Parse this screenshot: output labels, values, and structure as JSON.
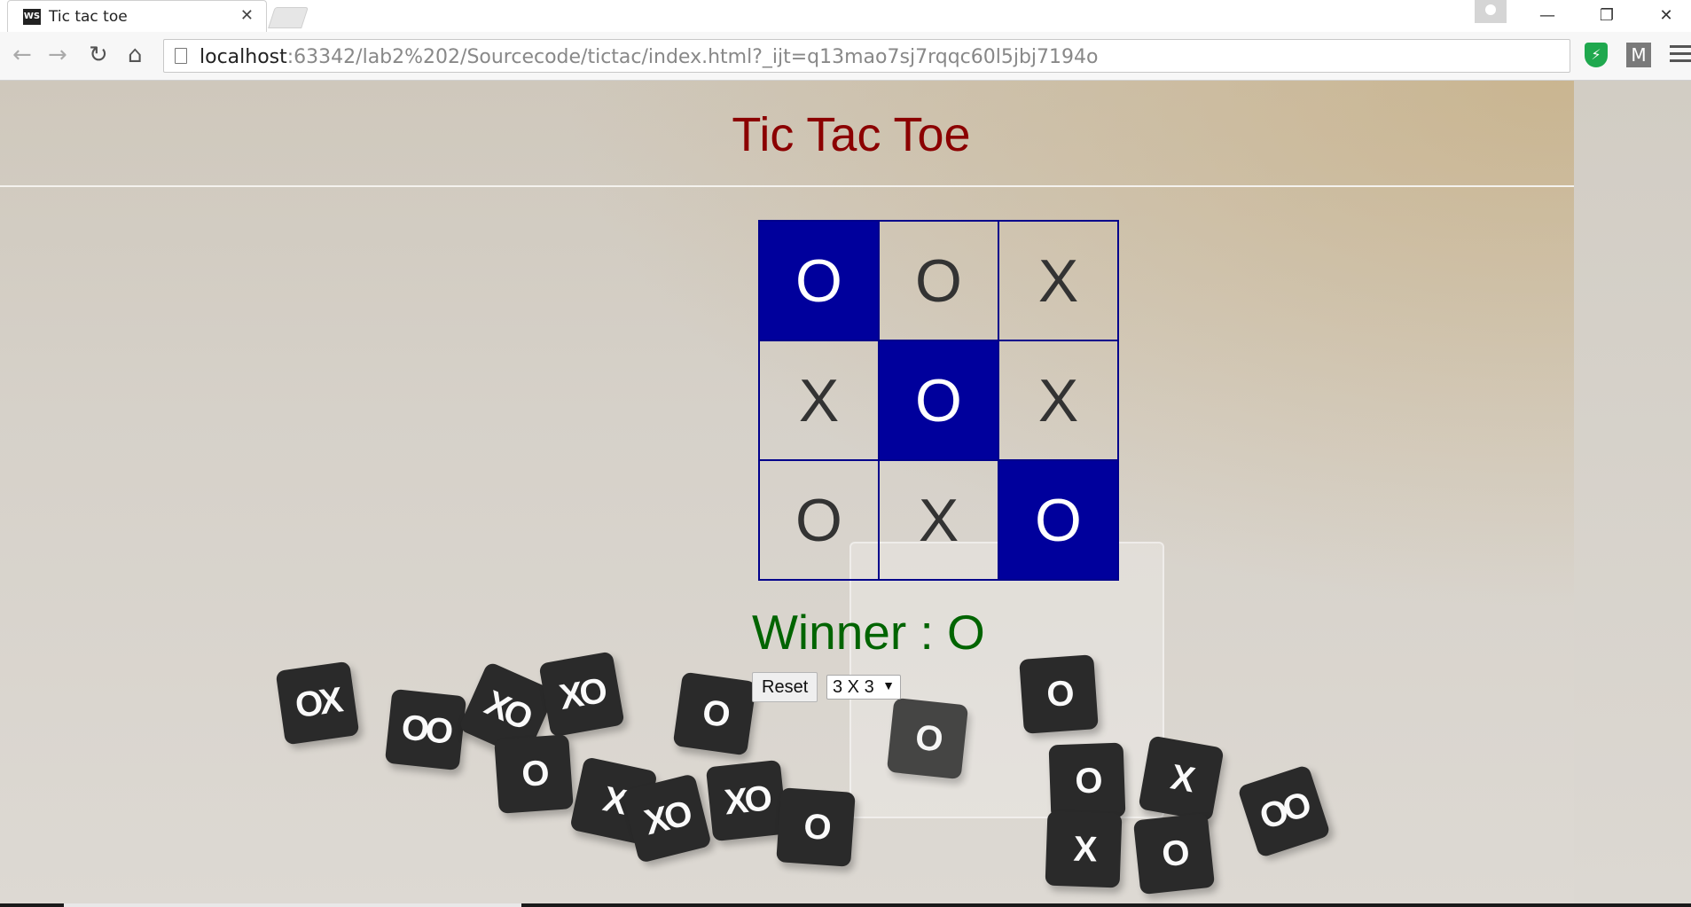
{
  "browser": {
    "tab_title": "Tic tac toe",
    "tab_favicon": "WS",
    "close_glyph": "✕",
    "url_host": "localhost",
    "url_rest": ":63342/lab2%202/Sourcecode/tictac/index.html?_ijt=q13mao7sj7rqqc60l5jbj7194o",
    "window_controls": {
      "minimize": "—",
      "restore": "❐",
      "close": "✕"
    },
    "ext_m": "M"
  },
  "game": {
    "title": "Tic Tac Toe",
    "board": [
      {
        "mark": "O",
        "highlight": true
      },
      {
        "mark": "O",
        "highlight": false
      },
      {
        "mark": "X",
        "highlight": false
      },
      {
        "mark": "X",
        "highlight": false
      },
      {
        "mark": "O",
        "highlight": true
      },
      {
        "mark": "X",
        "highlight": false
      },
      {
        "mark": "O",
        "highlight": false
      },
      {
        "mark": "X",
        "highlight": false
      },
      {
        "mark": "O",
        "highlight": true
      }
    ],
    "winner_text": "Winner : O",
    "reset_label": "Reset",
    "size_selected": "3 X 3",
    "colors": {
      "title": "#8b0000",
      "winner": "#006400",
      "highlight": "#00009c",
      "grid": "#00008b"
    }
  }
}
